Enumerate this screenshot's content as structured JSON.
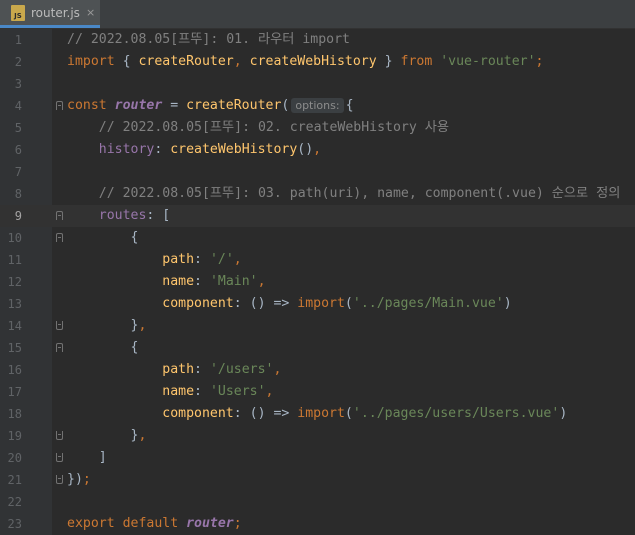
{
  "tab": {
    "filename": "router.js",
    "icon": "js-file-icon",
    "file_badge": "JS",
    "close": "×"
  },
  "colors": {
    "comment": "#808080",
    "keyword": "#cc7832",
    "function": "#ffc66d",
    "string": "#6a8759",
    "property": "#9876aa",
    "plain": "#a9b7c6",
    "background": "#2b2b2b"
  },
  "inlay_hint": "options:",
  "lines": [
    {
      "num": "1",
      "parts": [
        {
          "c": "t-comment",
          "t": "// 2022.08.05[프뚜]: 01. 라우터 import"
        }
      ]
    },
    {
      "num": "2",
      "parts": [
        {
          "c": "t-kw",
          "t": "import"
        },
        {
          "c": "t-plain",
          "t": " { "
        },
        {
          "c": "t-fn",
          "t": "createRouter"
        },
        {
          "c": "t-kw",
          "t": ", "
        },
        {
          "c": "t-fn",
          "t": "createWebHistory"
        },
        {
          "c": "t-plain",
          "t": " } "
        },
        {
          "c": "t-kw",
          "t": "from"
        },
        {
          "c": "t-plain",
          "t": " "
        },
        {
          "c": "t-str",
          "t": "'vue-router'"
        },
        {
          "c": "t-kw",
          "t": ";"
        }
      ]
    },
    {
      "num": "3",
      "parts": []
    },
    {
      "num": "4",
      "parts": [
        {
          "c": "t-kw",
          "t": "const "
        },
        {
          "c": "t-var",
          "t": "router"
        },
        {
          "c": "t-plain",
          "t": " = "
        },
        {
          "c": "t-fn",
          "t": "createRouter"
        },
        {
          "c": "t-plain",
          "t": "("
        },
        {
          "c": "t-hint",
          "t": "options:"
        },
        {
          "c": "t-plain",
          "t": "{"
        }
      ]
    },
    {
      "num": "5",
      "parts": [
        {
          "c": "t-comment",
          "t": "    // 2022.08.05[프뚜]: 02. createWebHistory 사용"
        }
      ]
    },
    {
      "num": "6",
      "parts": [
        {
          "c": "t-plain",
          "t": "    "
        },
        {
          "c": "t-prop",
          "t": "history"
        },
        {
          "c": "t-plain",
          "t": ": "
        },
        {
          "c": "t-fn",
          "t": "createWebHistory"
        },
        {
          "c": "t-plain",
          "t": "()"
        },
        {
          "c": "t-kw",
          "t": ","
        }
      ]
    },
    {
      "num": "7",
      "parts": []
    },
    {
      "num": "8",
      "parts": [
        {
          "c": "t-comment",
          "t": "    // 2022.08.05[프뚜]: 03. path(uri), name, component(.vue) 순으로 정의"
        }
      ]
    },
    {
      "num": "9",
      "parts": [
        {
          "c": "t-plain",
          "t": "    "
        },
        {
          "c": "t-prop",
          "t": "routes"
        },
        {
          "c": "t-plain",
          "t": ": ["
        }
      ]
    },
    {
      "num": "10",
      "parts": [
        {
          "c": "t-plain",
          "t": "        {"
        }
      ]
    },
    {
      "num": "11",
      "parts": [
        {
          "c": "t-plain",
          "t": "            "
        },
        {
          "c": "t-key",
          "t": "path"
        },
        {
          "c": "t-plain",
          "t": ": "
        },
        {
          "c": "t-str",
          "t": "'/'"
        },
        {
          "c": "t-kw",
          "t": ","
        }
      ]
    },
    {
      "num": "12",
      "parts": [
        {
          "c": "t-plain",
          "t": "            "
        },
        {
          "c": "t-key",
          "t": "name"
        },
        {
          "c": "t-plain",
          "t": ": "
        },
        {
          "c": "t-str",
          "t": "'Main'"
        },
        {
          "c": "t-kw",
          "t": ","
        }
      ]
    },
    {
      "num": "13",
      "parts": [
        {
          "c": "t-plain",
          "t": "            "
        },
        {
          "c": "t-key",
          "t": "component"
        },
        {
          "c": "t-plain",
          "t": ": () => "
        },
        {
          "c": "t-kw",
          "t": "import"
        },
        {
          "c": "t-plain",
          "t": "("
        },
        {
          "c": "t-str",
          "t": "'../pages/Main.vue'"
        },
        {
          "c": "t-plain",
          "t": ")"
        }
      ]
    },
    {
      "num": "14",
      "parts": [
        {
          "c": "t-plain",
          "t": "        }"
        },
        {
          "c": "t-kw",
          "t": ","
        }
      ]
    },
    {
      "num": "15",
      "parts": [
        {
          "c": "t-plain",
          "t": "        {"
        }
      ]
    },
    {
      "num": "16",
      "parts": [
        {
          "c": "t-plain",
          "t": "            "
        },
        {
          "c": "t-key",
          "t": "path"
        },
        {
          "c": "t-plain",
          "t": ": "
        },
        {
          "c": "t-str",
          "t": "'/users'"
        },
        {
          "c": "t-kw",
          "t": ","
        }
      ]
    },
    {
      "num": "17",
      "parts": [
        {
          "c": "t-plain",
          "t": "            "
        },
        {
          "c": "t-key",
          "t": "name"
        },
        {
          "c": "t-plain",
          "t": ": "
        },
        {
          "c": "t-str",
          "t": "'Users'"
        },
        {
          "c": "t-kw",
          "t": ","
        }
      ]
    },
    {
      "num": "18",
      "parts": [
        {
          "c": "t-plain",
          "t": "            "
        },
        {
          "c": "t-key",
          "t": "component"
        },
        {
          "c": "t-plain",
          "t": ": () => "
        },
        {
          "c": "t-kw",
          "t": "import"
        },
        {
          "c": "t-plain",
          "t": "("
        },
        {
          "c": "t-str",
          "t": "'../pages/users/Users.vue'"
        },
        {
          "c": "t-plain",
          "t": ")"
        }
      ]
    },
    {
      "num": "19",
      "parts": [
        {
          "c": "t-plain",
          "t": "        }"
        },
        {
          "c": "t-kw",
          "t": ","
        }
      ]
    },
    {
      "num": "20",
      "parts": [
        {
          "c": "t-plain",
          "t": "    ]"
        }
      ]
    },
    {
      "num": "21",
      "parts": [
        {
          "c": "t-plain",
          "t": "})"
        },
        {
          "c": "t-kw",
          "t": ";"
        }
      ]
    },
    {
      "num": "22",
      "parts": []
    },
    {
      "num": "23",
      "parts": [
        {
          "c": "t-kw",
          "t": "export default "
        },
        {
          "c": "t-var",
          "t": "router"
        },
        {
          "c": "t-kw",
          "t": ";"
        }
      ]
    }
  ],
  "current_line": "9",
  "fold_open": [
    "4",
    "9",
    "10",
    "15"
  ],
  "fold_close": [
    "14",
    "19",
    "20",
    "21"
  ]
}
